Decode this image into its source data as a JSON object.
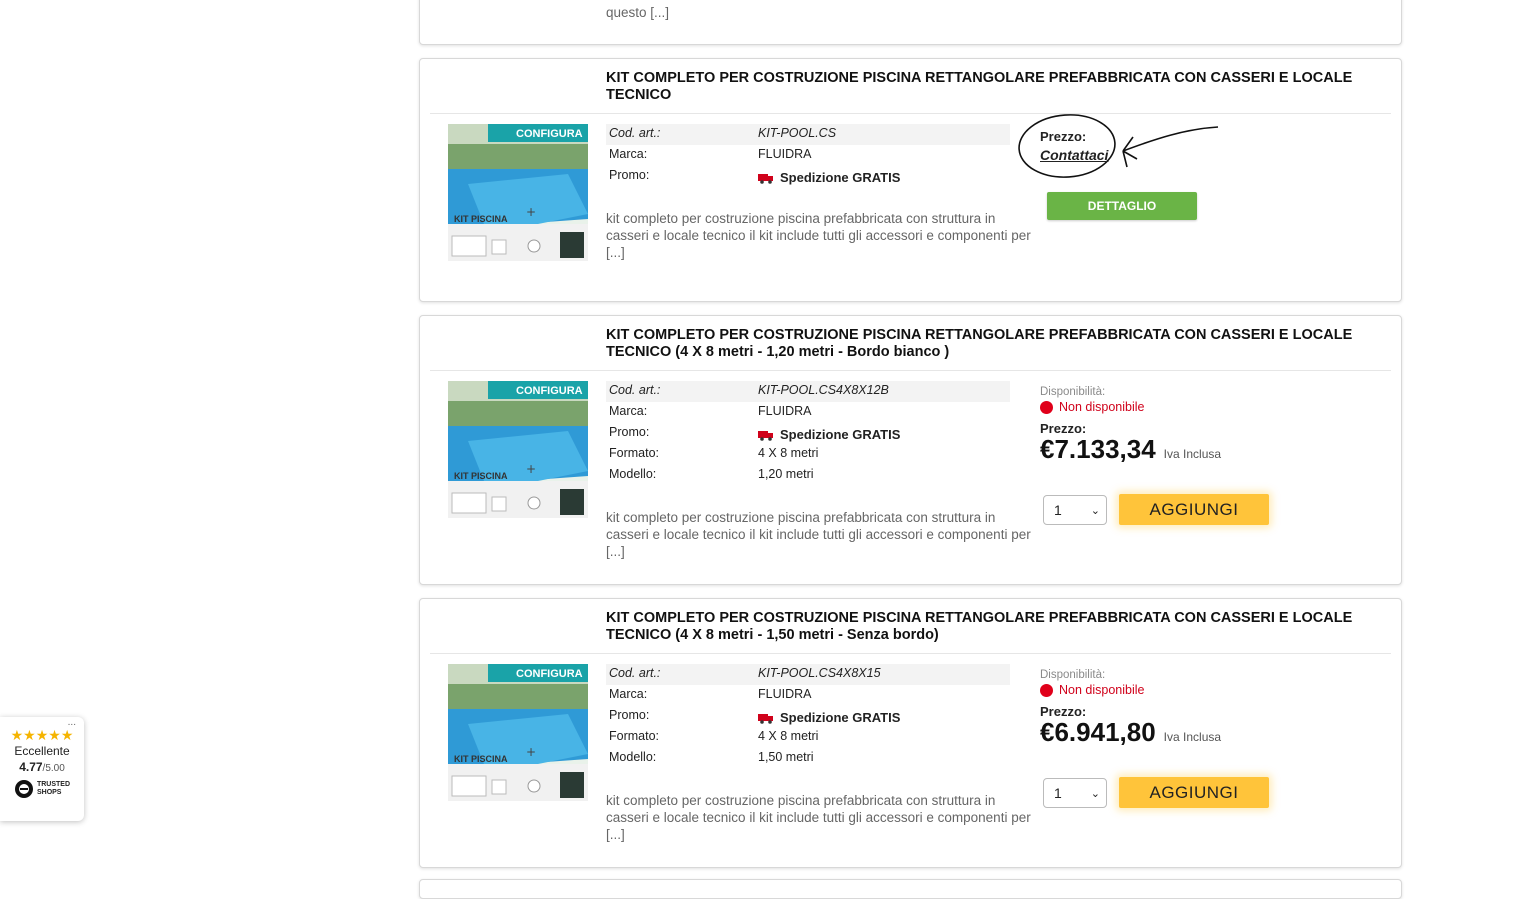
{
  "top_card": {
    "desc_tail": "questo [...]"
  },
  "labels": {
    "cod": "Cod. art.:",
    "marca": "Marca:",
    "promo": "Promo:",
    "formato": "Formato:",
    "modello": "Modello:",
    "avail": "Disponibilità:",
    "prezzo": "Prezzo:",
    "vat": "Iva Inclusa"
  },
  "products": [
    {
      "title": "KIT COMPLETO PER COSTRUZIONE PISCINA RETTANGOLARE PREFABBRICATA CON CASSERI E LOCALE TECNICO",
      "thumb": {
        "banner": "CONFIGURA",
        "tag": "KIT PISCINA"
      },
      "code": "KIT-POOL.CS",
      "brand": "FLUIDRA",
      "promo": "Spedizione GRATIS",
      "description": "kit completo per costruzione piscina prefabbricata con struttura in casseri e locale tecnico il kit include tutti gli accessori e componenti per [...]",
      "price_label": "Prezzo:",
      "price_contact": "Contattaci",
      "detail_button": "DETTAGLIO"
    },
    {
      "title": "KIT COMPLETO PER COSTRUZIONE PISCINA RETTANGOLARE PREFABBRICATA CON CASSERI E LOCALE TECNICO (4 X 8 metri - 1,20 metri - Bordo bianco )",
      "thumb": {
        "banner": "CONFIGURA",
        "tag": "KIT PISCINA"
      },
      "code": "KIT-POOL.CS4X8X12B",
      "brand": "FLUIDRA",
      "promo": "Spedizione GRATIS",
      "format": "4 X 8 metri",
      "model": "1,20 metri",
      "description": "kit completo per costruzione piscina prefabbricata con struttura in casseri e locale tecnico il kit include tutti gli accessori e componenti per [...]",
      "availability": "Non disponibile",
      "price": "€7.133,34",
      "qty": "1",
      "add_button": "AGGIUNGI"
    },
    {
      "title": "KIT COMPLETO PER COSTRUZIONE PISCINA RETTANGOLARE PREFABBRICATA CON CASSERI E LOCALE TECNICO (4 X 8 metri - 1,50 metri - Senza bordo)",
      "thumb": {
        "banner": "CONFIGURA",
        "tag": "KIT PISCINA"
      },
      "code": "KIT-POOL.CS4X8X15",
      "brand": "FLUIDRA",
      "promo": "Spedizione GRATIS",
      "format": "4 X 8 metri",
      "model": "1,50 metri",
      "description": "kit completo per costruzione piscina prefabbricata con struttura in casseri e locale tecnico il kit include tutti gli accessori e componenti per [...]",
      "availability": "Non disponibile",
      "price": "€6.941,80",
      "qty": "1",
      "add_button": "AGGIUNGI"
    }
  ],
  "trust_badge": {
    "stars": "★★★★★",
    "rating_text": "Eccellente",
    "score": "4.77",
    "max": "/5.00",
    "brand_line1": "TRUSTED",
    "brand_line2": "SHOPS",
    "menu": "..."
  },
  "colors": {
    "add_button": "#ffc43a",
    "detail_button": "#6ab446",
    "unavailable": "#e0001a"
  }
}
